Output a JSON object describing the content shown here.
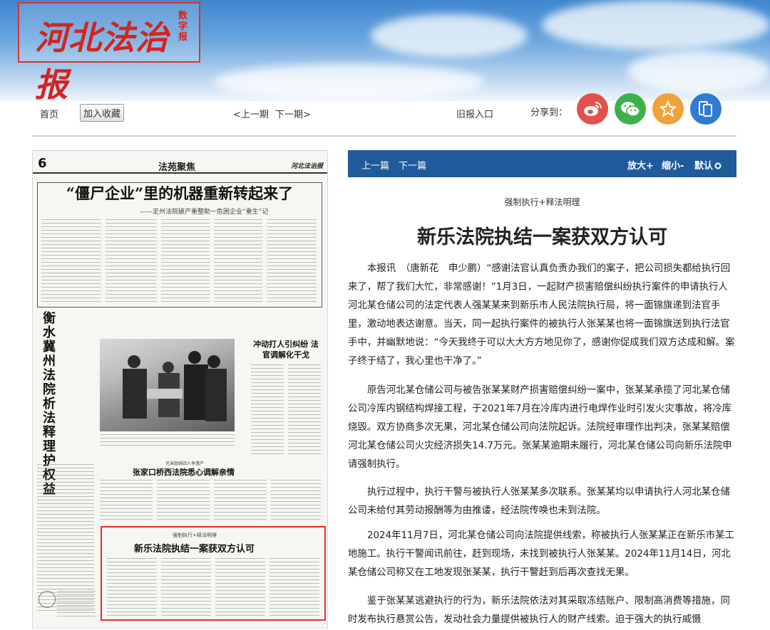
{
  "masthead": {
    "title": "河北法治报",
    "sub": "数字报"
  },
  "nav": {
    "home": "首页",
    "favorite": "加入收藏",
    "prev_issue": "<上一期",
    "next_issue": "下一期>",
    "archive": "旧报入口",
    "share_label": "分享到："
  },
  "share": [
    {
      "name": "weibo",
      "icon": "weibo-icon",
      "color": "#e0524a"
    },
    {
      "name": "wechat",
      "icon": "wechat-icon",
      "color": "#3cb34a"
    },
    {
      "name": "qzone",
      "icon": "star-icon",
      "color": "#f0a23a"
    },
    {
      "name": "mobile",
      "icon": "mobile-icon",
      "color": "#2e7bd1"
    }
  ],
  "page": {
    "number": "6",
    "section": "法苑聚焦",
    "headline1": "“僵尸企业”里的机器重新转起来了",
    "headline1_sub": "——定州法院破产重整助一危困企业“重生”记",
    "vertical_title": "衡水冀州法院析法释理护权益",
    "headline_right": "冲动打人引纠纷 法官调解化干戈",
    "headline3": "张家口桥西法院悉心调解亲情",
    "kicker3": "兄弟姐妹四人争遗产",
    "kicker4": "强制执行+释法明理",
    "headline4": "新乐法院执结一案获双方认可"
  },
  "article": {
    "bar": {
      "prev": "上一篇",
      "next": "下一篇",
      "zoom_in": "放大+",
      "zoom_out": "缩小-",
      "default": "默认"
    },
    "kicker": "强制执行+释法明理",
    "title": "新乐法院执结一案获双方认可",
    "paragraphs": [
      "本报讯　（唐新花　申少鹏）“感谢法官认真负责办我们的案子，把公司损失都给执行回来了，帮了我们大忙，非常感谢！”1月3日，一起财产损害赔偿纠纷执行案件的申请执行人河北某仓储公司的法定代表人强某某来到新乐市人民法院执行局，将一面锦旗递到法官手里，激动地表达谢意。当天，同一起执行案件的被执行人张某某也将一面锦旗送到执行法官手中，并幽默地说：“今天我终于可以大大方方地见你了，感谢你促成我们双方达成和解。案子终于结了，我心里也干净了。”",
      "原告河北某仓储公司与被告张某某财产损害赔偿纠纷一案中，张某某承揽了河北某仓储公司冷库内钢结构焊接工程，于2021年7月在冷库内进行电焊作业时引发火灾事故，将冷库烧毁。双方协商多次无果，河北某仓储公司向法院起诉。法院经审理作出判决，张某某赔偿河北某仓储公司火灾经济损失14.7万元。张某某逾期未履行，河北某仓储公司向新乐法院申请强制执行。",
      "执行过程中，执行干警与被执行人张某某多次联系。张某某均以申请执行人河北某仓储公司未给付其劳动报酬等为由推诿，经法院传唤也未到法院。",
      "2024年11月7日，河北某仓储公司向法院提供线索，称被执行人张某某正在新乐市某工地施工。执行干警闻讯前往，赶到现场，未找到被执行人张某某。2024年11月14日，河北某仓储公司称又在工地发现张某某，执行干警赶到后再次查找无果。",
      "鉴于张某某逃避执行的行为，新乐法院依法对其采取冻结账户、限制高消费等措施，同时发布执行悬赏公告，发动社会力量提供被执行人的财产线索。迫于强大的执行威慑"
    ]
  }
}
